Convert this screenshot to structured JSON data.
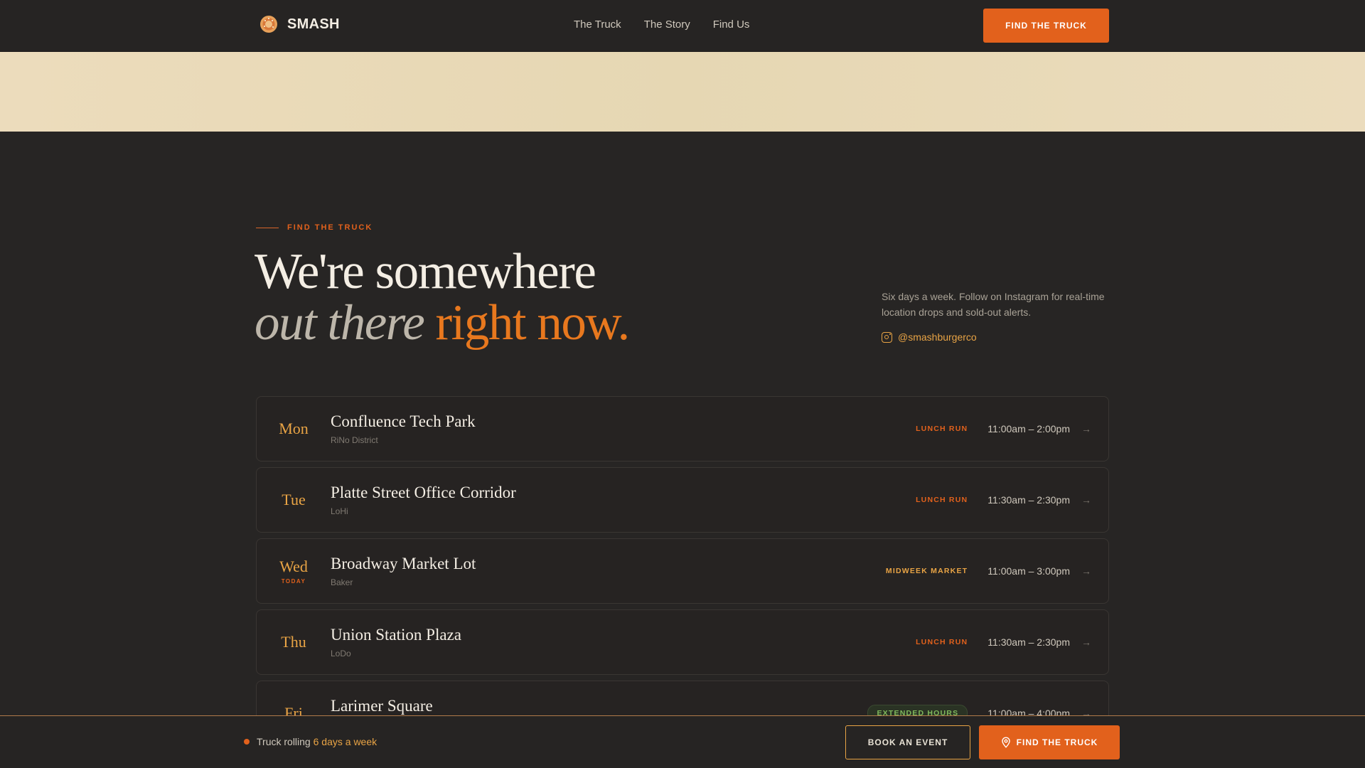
{
  "nav": {
    "brand": "SMASH",
    "links": [
      "The Truck",
      "The Story",
      "Find Us"
    ],
    "cta": "FIND THE TRUCK"
  },
  "hero": {
    "eyebrow": "FIND THE TRUCK",
    "title_line1": "We're somewhere",
    "title_italic": "out there",
    "title_accent": "right now.",
    "description": "Six days a week. Follow on Instagram for real-time location drops and sold-out alerts.",
    "instagram": "@smashburgerco"
  },
  "schedule": [
    {
      "day": "Mon",
      "today": "",
      "location": "Confluence Tech Park",
      "area": "RiNo District",
      "tag": "LUNCH RUN",
      "tag_style": "lunch",
      "hours": "11:00am – 2:00pm"
    },
    {
      "day": "Tue",
      "today": "",
      "location": "Platte Street Office Corridor",
      "area": "LoHi",
      "tag": "LUNCH RUN",
      "tag_style": "lunch",
      "hours": "11:30am – 2:30pm"
    },
    {
      "day": "Wed",
      "today": "TODAY",
      "location": "Broadway Market Lot",
      "area": "Baker",
      "tag": "MIDWEEK MARKET",
      "tag_style": "midweek",
      "hours": "11:00am – 3:00pm"
    },
    {
      "day": "Thu",
      "today": "",
      "location": "Union Station Plaza",
      "area": "LoDo",
      "tag": "LUNCH RUN",
      "tag_style": "lunch",
      "hours": "11:30am – 2:30pm"
    },
    {
      "day": "Fri",
      "today": "",
      "location": "Larimer Square",
      "area": "",
      "tag": "EXTENDED HOURS",
      "tag_style": "extended",
      "hours": "11:00am – 4:00pm"
    }
  ],
  "bottombar": {
    "status_prefix": "Truck rolling",
    "status_highlight": "6 days a week",
    "book_event": "BOOK AN EVENT",
    "find_truck": "FIND THE TRUCK"
  },
  "colors": {
    "accent": "#e2611c",
    "gold": "#e9a445",
    "background": "#272524",
    "cream": "#e6d7b3",
    "extended_green": "#7fb85c"
  },
  "icons": {
    "brand": "burger-logo-icon",
    "instagram": "instagram-icon",
    "row_arrow": "arrow-right-icon",
    "find": "map-pin-icon"
  }
}
